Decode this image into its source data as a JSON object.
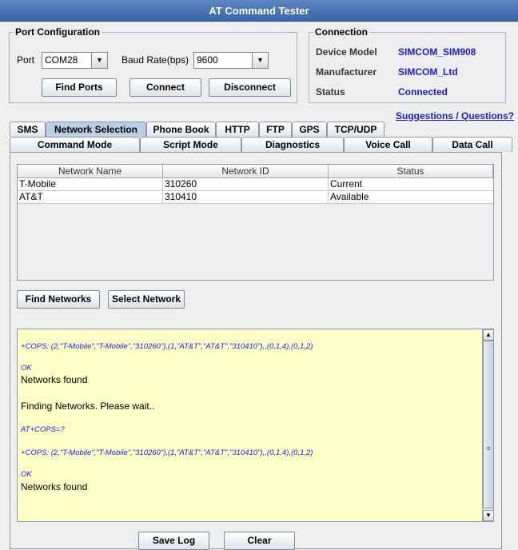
{
  "window": {
    "title": "AT Command Tester"
  },
  "port_config": {
    "title": "Port Configuration",
    "port_label": "Port",
    "port_value": "COM28",
    "baud_label": "Baud Rate(bps)",
    "baud_value": "9600",
    "find_ports": "Find Ports",
    "connect": "Connect",
    "disconnect": "Disconnect"
  },
  "connection": {
    "title": "Connection",
    "device_model_label": "Device Model",
    "device_model_value": "SIMCOM_SIM908",
    "manufacturer_label": "Manufacturer",
    "manufacturer_value": "SIMCOM_Ltd",
    "status_label": "Status",
    "status_value": "Connected"
  },
  "suggestions_link": "Suggestions / Questions?",
  "tabs_top": [
    "SMS",
    "Network Selection",
    "Phone Book",
    "HTTP",
    "FTP",
    "GPS",
    "TCP/UDP"
  ],
  "tabs_bottom": [
    "Command Mode",
    "Script Mode",
    "Diagnostics",
    "Voice Call",
    "Data Call"
  ],
  "active_tab": "Network Selection",
  "table": {
    "columns": [
      "Network Name",
      "Network ID",
      "Status"
    ],
    "rows": [
      [
        "T-Mobile",
        "310260",
        "Current"
      ],
      [
        "AT&T",
        "310410",
        "Available"
      ]
    ]
  },
  "buttons": {
    "find_networks": "Find Networks",
    "select_network": "Select Network",
    "save_log": "Save Log",
    "clear": "Clear"
  },
  "log": [
    {
      "type": "cmd",
      "text": "+COPS: (2,\"T-Mobile\",\"T-Mobile\",\"310260\"),(1,\"AT&T\",\"AT&T\",\"310410\"),,(0,1,4),(0,1,2)"
    },
    {
      "type": "cmd",
      "text": "OK"
    },
    {
      "type": "msg",
      "text": "Networks found"
    },
    {
      "type": "msg",
      "text": "Finding Networks. Please wait.."
    },
    {
      "type": "cmd",
      "text": "AT+COPS=?"
    },
    {
      "type": "cmd",
      "text": "+COPS: (2,\"T-Mobile\",\"T-Mobile\",\"310260\"),(1,\"AT&T\",\"AT&T\",\"310410\"),,(0,1,4),(0,1,2)"
    },
    {
      "type": "cmd",
      "text": "OK"
    },
    {
      "type": "msg",
      "text": "Networks found"
    }
  ],
  "icons": {
    "dropdown": "chevron-down-icon",
    "scroll_up": "scroll-up-icon",
    "scroll_down": "scroll-down-icon",
    "scroll_grip": "scroll-grip-icon"
  },
  "colors": {
    "titlebar": "#3a66a8",
    "value_blue": "#1b1be0",
    "log_background": "#ffffc8",
    "active_tab": "#b8cfe5"
  }
}
